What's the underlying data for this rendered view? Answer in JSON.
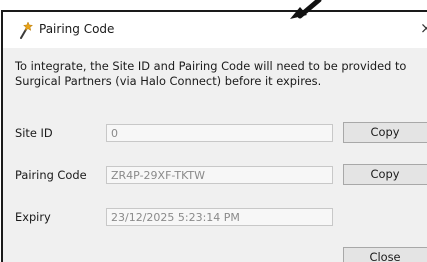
{
  "dialog": {
    "title": "Pairing Code",
    "close_glyph": "×",
    "intro_text": "To integrate, the Site ID and Pairing Code will need to be provided to Surgical Partners (via Halo Connect) before it expires."
  },
  "rows": {
    "site_id": {
      "label": "Site ID",
      "value": "0",
      "button": "Copy"
    },
    "pairing_code": {
      "label": "Pairing Code",
      "value": "ZR4P-29XF-TKTW",
      "button": "Copy"
    },
    "expiry": {
      "label": "Expiry",
      "value": "23/12/2025 5:23:14 PM"
    }
  },
  "footer": {
    "close_label": "Close"
  },
  "icons": {
    "title": "wand-icon",
    "close": "close-icon",
    "pointer": "arrow-pointer-icon"
  },
  "colors": {
    "dialog_bg": "#f0f0f0",
    "border": "#1a1a1a",
    "button_bg": "#e4e4e4"
  }
}
